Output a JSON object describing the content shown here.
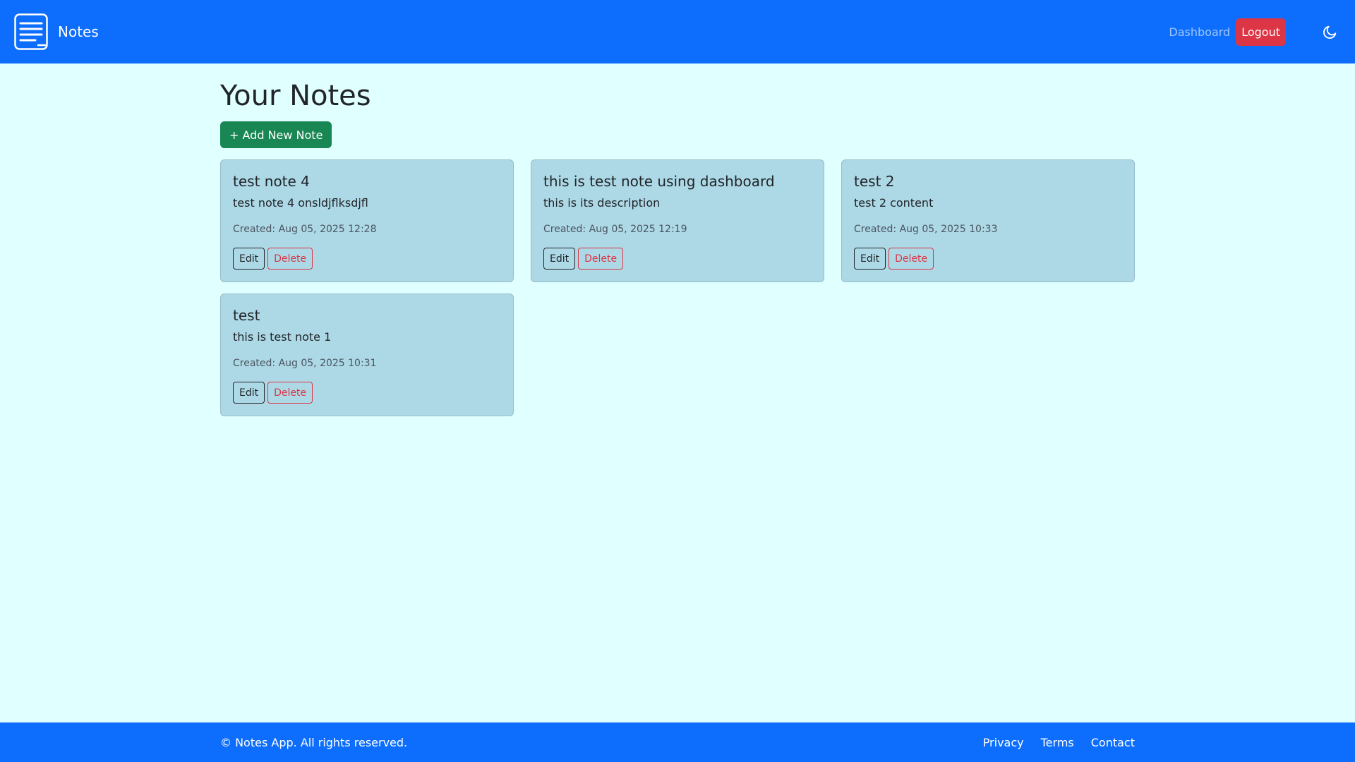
{
  "navbar": {
    "brand_icon": "notes-icon",
    "brand_label": "Notes",
    "dashboard_link": "Dashboard",
    "logout_label": "Logout",
    "theme_icon": "moon-icon"
  },
  "main": {
    "title": "Your Notes",
    "add_button": "+ Add New Note",
    "notes": [
      {
        "title": "test note 4",
        "content": "test note 4 onsldjflksdjfl",
        "created": "Created: Aug 05, 2025 12:28",
        "edit": "Edit",
        "delete": "Delete"
      },
      {
        "title": "this is test note using dashboard",
        "content": "this is its description",
        "created": "Created: Aug 05, 2025 12:19",
        "edit": "Edit",
        "delete": "Delete"
      },
      {
        "title": "test 2",
        "content": "test 2 content",
        "created": "Created: Aug 05, 2025 10:33",
        "edit": "Edit",
        "delete": "Delete"
      },
      {
        "title": "test",
        "content": "this is test note 1",
        "created": "Created: Aug 05, 2025 10:31",
        "edit": "Edit",
        "delete": "Delete"
      }
    ]
  },
  "footer": {
    "copyright": "© Notes App. All rights reserved.",
    "links": [
      "Privacy",
      "Terms",
      "Contact"
    ]
  },
  "colors": {
    "navbar": "#0d6efd",
    "page_background": "#e0ffff",
    "card_background": "#add8e6",
    "add_button": "#198754",
    "logout_button": "#dc3545"
  }
}
